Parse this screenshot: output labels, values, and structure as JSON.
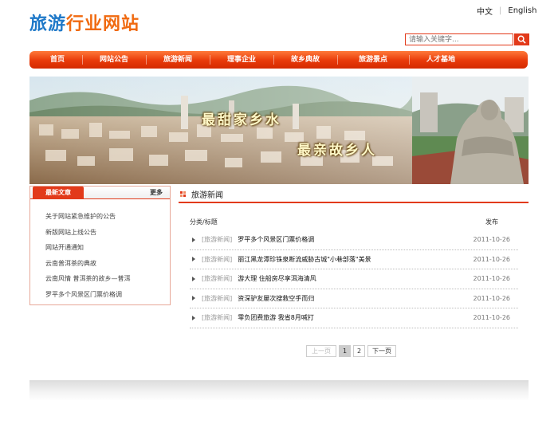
{
  "header": {
    "logo_part1": "旅游",
    "logo_part2": "行业网站",
    "lang_cn": "中文",
    "lang_en": "English",
    "search_placeholder": "请输入关键字..."
  },
  "nav": [
    "首页",
    "网站公告",
    "旅游新闻",
    "理事企业",
    "故乡典故",
    "旅游景点",
    "人才基地"
  ],
  "banner": {
    "slogan1": "最甜家乡水",
    "slogan2": "最亲故乡人"
  },
  "latest": {
    "tab": "最新文章",
    "more": "更多",
    "items": [
      "关于网站紧急维护的公告",
      "新版网站上线公告",
      "网站开通通知",
      "云南普洱茶的典故",
      "云南风情 普洱茶的故乡—普洱",
      "罗平多个风景区门票价格调"
    ]
  },
  "news": {
    "title": "旅游新闻",
    "col_category": "分类/标题",
    "col_published": "发布",
    "rows": [
      {
        "cat": "[旅游新闻]",
        "title": "罗平多个风景区门票价格调",
        "date": "2011-10-26"
      },
      {
        "cat": "[旅游新闻]",
        "title": "丽江黑龙潭珍铢泉断流威胁古城\"小巷部落\"美景",
        "date": "2011-10-26"
      },
      {
        "cat": "[旅游新闻]",
        "title": "游大理 住船房尽享洱海清风",
        "date": "2011-10-26"
      },
      {
        "cat": "[旅游新闻]",
        "title": "资深驴友屡次搜救空手而归",
        "date": "2011-10-26"
      },
      {
        "cat": "[旅游新闻]",
        "title": "零负团费旅游 我省8月喊打",
        "date": "2011-10-26"
      }
    ]
  },
  "pager": {
    "prev": "上一页",
    "page1": "1",
    "page2": "2",
    "next": "下一页"
  },
  "colors": {
    "accent": "#e23a1a",
    "logo_blue": "#1e78c8",
    "logo_orange": "#f06a10"
  }
}
